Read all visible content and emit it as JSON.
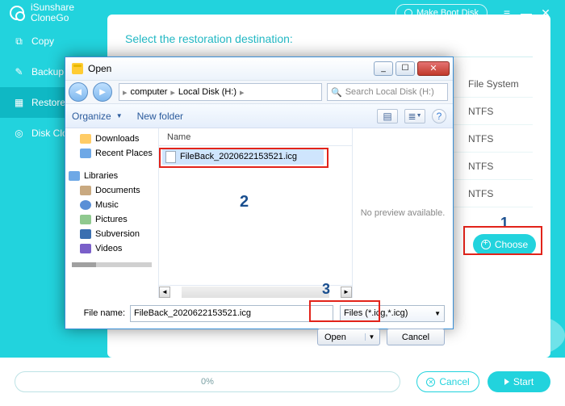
{
  "brand": {
    "line1": "iSunshare",
    "line2": "CloneGo"
  },
  "titlebar": {
    "boot": "Make Boot Disk"
  },
  "sidebar": {
    "items": [
      {
        "label": "Copy"
      },
      {
        "label": "Backup"
      },
      {
        "label": "Restore"
      },
      {
        "label": "Disk Clone"
      }
    ]
  },
  "main": {
    "heading": "Select the restoration destination:",
    "fs_header": "File System",
    "fs": "NTFS"
  },
  "choose": {
    "label": "Choose"
  },
  "steps": {
    "s1": "1",
    "s2": "2",
    "s3": "3"
  },
  "bottom": {
    "progress": "0%",
    "cancel": "Cancel",
    "start": "Start"
  },
  "dialog": {
    "title": "Open",
    "crumbs": {
      "a": "computer",
      "b": "Local Disk (H:)"
    },
    "search": "Search Local Disk (H:)",
    "toolbar": {
      "organize": "Organize",
      "newfolder": "New folder"
    },
    "tree": {
      "downloads": "Downloads",
      "recent": "Recent Places",
      "libraries": "Libraries",
      "documents": "Documents",
      "music": "Music",
      "pictures": "Pictures",
      "subversion": "Subversion",
      "videos": "Videos"
    },
    "col": {
      "name": "Name"
    },
    "file": "FileBack_2020622153521.icg",
    "preview": "No preview available.",
    "fname_label": "File name:",
    "filter": "Files (*.icg,*.icg)",
    "open": "Open",
    "cancel": "Cancel"
  }
}
